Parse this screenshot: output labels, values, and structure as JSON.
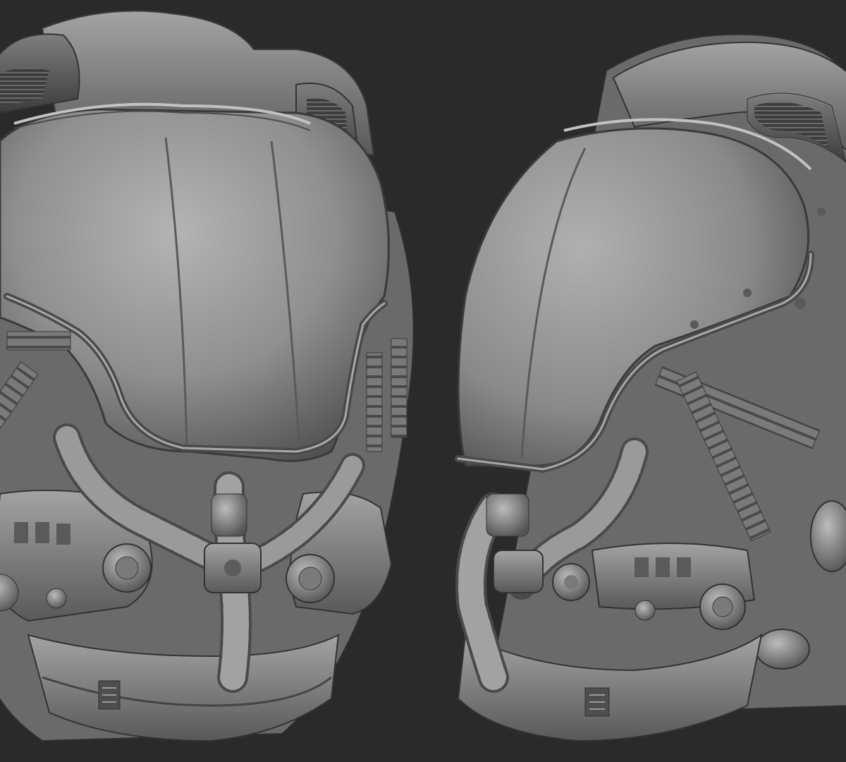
{
  "scene": {
    "background_color": "#2a2a2a",
    "material_color": "#8e8e8e",
    "subject_count": 2
  },
  "views": [
    {
      "view": "front-three-quarter"
    },
    {
      "view": "side-profile"
    }
  ]
}
